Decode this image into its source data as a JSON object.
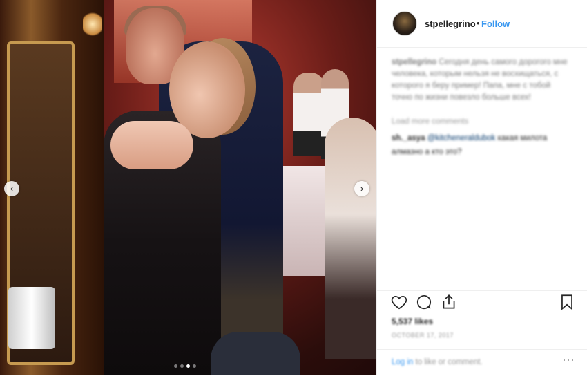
{
  "post": {
    "username": "stpellegrino",
    "separator": "•",
    "follow_label": "Follow",
    "caption_text": "Сегодня день самого дорогого мне человека, которым нельзя не восхищаться, с которого я беру пример! Папа, мне с тобой точно по жизни повезло больше всех!",
    "load_more": "Load more comments",
    "comments": [
      {
        "user": "sh._asya",
        "mention": "@kitcheneraldubok",
        "text": "какая милота"
      },
      {
        "user": "",
        "mention": "",
        "text": "алмазно а кто это?"
      }
    ],
    "likes": "5,537 likes",
    "date": "OCTOBER 17, 2017",
    "login_link": "Log in",
    "login_text": "to like or comment.",
    "more_glyph": "···"
  },
  "carousel": {
    "prev_glyph": "‹",
    "next_glyph": "›",
    "slide_count": 4,
    "active_slide": 3
  },
  "icons": [
    "heart-icon",
    "comment-icon",
    "share-icon",
    "bookmark-icon",
    "chevron-left-icon",
    "chevron-right-icon"
  ],
  "colors": {
    "link": "#3897f0",
    "text": "#262626",
    "muted": "#999999"
  }
}
